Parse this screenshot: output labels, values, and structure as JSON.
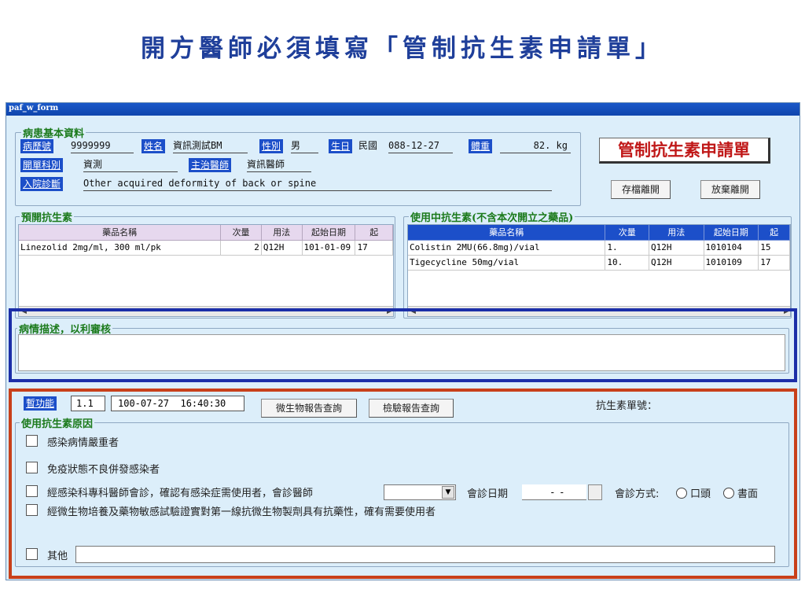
{
  "slide_title": "開方醫師必須填寫「管制抗生素申請單」",
  "window": {
    "title": "paf_w_form"
  },
  "patient": {
    "group_title": "病患基本資料",
    "chart_no_label": "病歷號",
    "chart_no": "9999999",
    "name_label": "姓名",
    "name": "資訊測試BM",
    "sex_label": "性別",
    "sex": "男",
    "birth_label": "生日",
    "birth_prefix": "民國",
    "birth": "088-12-27",
    "weight_label": "體重",
    "weight": "82. kg",
    "dept_label": "開單科別",
    "dept": "資測",
    "doctor_label": "主治醫師",
    "doctor": "資訊醫師",
    "diag_label": "入院診斷",
    "diag": "Other acquired deformity of back or spine"
  },
  "form_title": "管制抗生素申請單",
  "buttons": {
    "save_exit": "存檔離開",
    "discard_exit": "放棄離開",
    "micro": "微生物報告查詢",
    "lab": "檢驗報告查詢"
  },
  "prescribe": {
    "group_title": "預開抗生素",
    "columns": [
      "藥品名稱",
      "次量",
      "用法",
      "起始日期",
      "起"
    ],
    "rows": [
      [
        "Linezolid  2mg/ml, 300 ml/pk",
        "2",
        "Q12H",
        "101-01-09",
        "17"
      ]
    ]
  },
  "current": {
    "group_title": "使用中抗生素(不含本次開立之藥品)",
    "columns": [
      "藥品名稱",
      "次量",
      "用法",
      "起始日期",
      "起"
    ],
    "rows": [
      [
        "Colistin 2MU(66.8mg)/vial",
        "1.",
        "Q12H",
        "1010104",
        "15"
      ],
      [
        "Tigecycline 50mg/vial",
        "10.",
        "Q12H",
        "1010109",
        "17"
      ]
    ]
  },
  "description": {
    "title": "病情描述，以利審核",
    "value": ""
  },
  "bottom": {
    "func_label": "暫功能",
    "func_value": "1.1",
    "datetime": "100-07-27  16:40:30",
    "order_no_label": "抗生素單號：",
    "reason_title": "使用抗生素原因",
    "reasons": [
      "感染病情嚴重者",
      "免疫狀態不良併發感染者",
      "經感染科專科醫師會診，確認有感染症需使用者，會診醫師",
      "經微生物培養及藥物敏感試驗證實對第一線抗微生物製劑具有抗藥性，確有需要使用者",
      "其他"
    ],
    "consult_date_label": "會診日期",
    "consult_date_value": "  -  -",
    "consult_mode_label": "會診方式:",
    "mode_oral": "口頭",
    "mode_written": "書面"
  }
}
